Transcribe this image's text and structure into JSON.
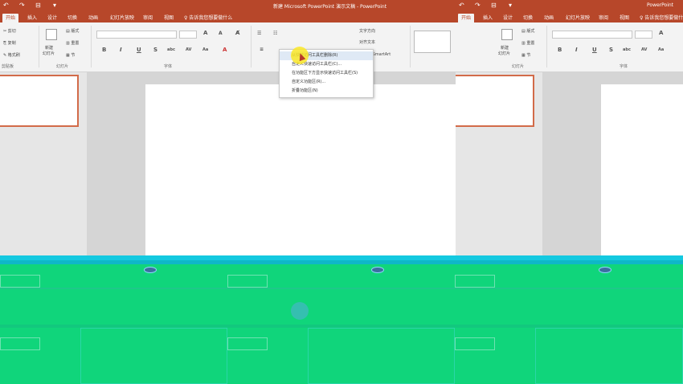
{
  "window": {
    "title": "新建 Microsoft PowerPoint 演示文稿 - PowerPoint",
    "title_b": "PowerPoint"
  },
  "qat": {
    "undo": "↶",
    "redo": "↷",
    "customize": "▾"
  },
  "tabs": [
    {
      "label": "开始",
      "active": true
    },
    {
      "label": "插入"
    },
    {
      "label": "设计"
    },
    {
      "label": "切换"
    },
    {
      "label": "动画"
    },
    {
      "label": "幻灯片放映"
    },
    {
      "label": "审阅"
    },
    {
      "label": "视图"
    }
  ],
  "tell_me": "♀ 告诉我您想要做什么",
  "ribbon": {
    "clipboard": {
      "cut": "剪切",
      "copy": "复制",
      "format_painter": "格式刷",
      "group": "剪贴板"
    },
    "slides": {
      "new_slide": "新建",
      "new_slide2": "幻灯片",
      "layout": "版式",
      "reset": "重置",
      "section": "节",
      "group": "幻灯片"
    },
    "font": {
      "group": "字体",
      "bold": "B",
      "italic": "I",
      "underline": "U",
      "strike": "S",
      "shadow": "abc",
      "spacing": "AV",
      "case": "Aa",
      "grow": "A",
      "shrink": "A"
    },
    "paragraph": {
      "text_direction": "文字方向",
      "align_text": "对齐文本",
      "smartart": "转换为 SmartArt"
    }
  },
  "context_menu": {
    "items": [
      "从快速访问工具栏删除(R)",
      "自定义快速访问工具栏(C)...",
      "在功能区下方显示快速访问工具栏(S)",
      "自定义功能区(R)...",
      "折叠功能区(N)"
    ],
    "highlighted": 0
  },
  "colors": {
    "title_bar": "#b7472a",
    "ribbon": "#f3f3f3",
    "workspace": "#d5d5d5",
    "glitch": "#10d57b",
    "glitch_cyan": "#14c9e0"
  }
}
